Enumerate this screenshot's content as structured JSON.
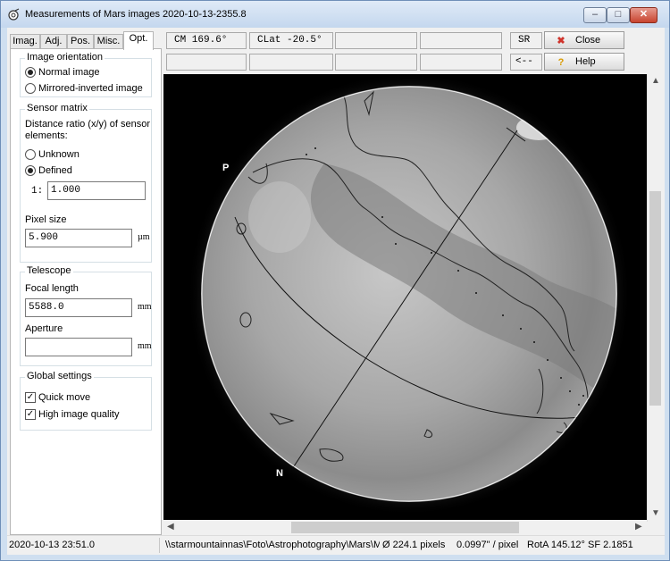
{
  "window": {
    "title": "Measurements of Mars images  2020-10-13-2355.8",
    "minimize": "–",
    "maximize": "□",
    "close": "✕"
  },
  "tabs": [
    {
      "label": "Imag."
    },
    {
      "label": "Adj."
    },
    {
      "label": "Pos."
    },
    {
      "label": "Misc."
    },
    {
      "label": "Opt."
    }
  ],
  "orientation": {
    "title": "Image orientation",
    "normal": "Normal image",
    "mirrored": "Mirrored-inverted image",
    "selected": "normal"
  },
  "sensor": {
    "title": "Sensor matrix",
    "description": "Distance ratio (x/y) of sensor elements:",
    "unknown": "Unknown",
    "defined": "Defined",
    "selected": "defined",
    "ratio_prefix": "1:",
    "ratio_value": "1.000",
    "pixel_size_label": "Pixel size",
    "pixel_size_value": "5.900",
    "pixel_size_unit": "µm"
  },
  "telescope": {
    "title": "Telescope",
    "focal_label": "Focal length",
    "focal_value": "5588.0",
    "focal_unit": "mm",
    "aperture_label": "Aperture",
    "aperture_value": "",
    "aperture_unit": "mm"
  },
  "global": {
    "title": "Global settings",
    "quick_move": "Quick move",
    "quick_move_checked": true,
    "high_quality": "High image quality",
    "high_quality_checked": true
  },
  "readouts": {
    "cm": "CM  169.6°",
    "clat": "CLat -20.5°",
    "sr": "SR",
    "back": "<--"
  },
  "buttons": {
    "close": "Close",
    "help": "Help",
    "close_icon_color": "#d0342c",
    "help_icon_color": "#d99a00"
  },
  "image": {
    "pole_p": "P",
    "pole_n": "N"
  },
  "status": {
    "datetime": "2020-10-13  23:51.0",
    "path": "\\\\starmountainnas\\Foto\\Astrophotography\\Mars\\Ma",
    "diameter": "Ø 224.1 pixels",
    "scale": "0.0997\" / pixel",
    "rotation": "RotA 145.12°",
    "sf": "SF 2.1851"
  },
  "colors": {
    "titlebar": "#c9dcf2",
    "close_button": "#c8442f"
  }
}
